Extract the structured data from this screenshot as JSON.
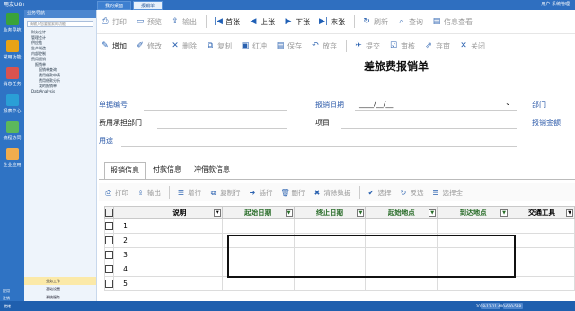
{
  "app": {
    "title": "用友U8+",
    "tabs": [
      "我的桌面",
      "报销单"
    ],
    "user_area": "用户 系统管理"
  },
  "leftbar": [
    "业务导航",
    "常用功能",
    "消息任务",
    "报表中心",
    "流程协同",
    "企业应用"
  ],
  "leftbar_bottom": [
    "应用",
    "注销",
    "退出"
  ],
  "sidebar": {
    "header": "业务导航",
    "search_placeholder": "请输入您要搜索的功能",
    "tree": [
      "财务会计",
      "管理会计",
      "供应链",
      "生产制造",
      "内部控制",
      "费用报销",
      "报销单",
      "报销单查询",
      "费用借款申请",
      "费用借款分析",
      "我的报销单",
      "DataAnalysis"
    ],
    "bottom": [
      "业务工作",
      "基础设置",
      "系统服务"
    ]
  },
  "toolbar1": [
    {
      "icon": "printer-icon",
      "glyph": "⎙",
      "label": "打印",
      "active": false
    },
    {
      "icon": "preview-icon",
      "glyph": "▭",
      "label": "预览",
      "active": false
    },
    {
      "icon": "export-icon",
      "glyph": "⇪",
      "label": "输出",
      "active": false
    },
    {
      "icon": "first-icon",
      "glyph": "|◀",
      "label": "首张",
      "active": true
    },
    {
      "icon": "prev-icon",
      "glyph": "◀",
      "label": "上张",
      "active": true
    },
    {
      "icon": "next-icon",
      "glyph": "▶",
      "label": "下张",
      "active": true
    },
    {
      "icon": "last-icon",
      "glyph": "▶|",
      "label": "末张",
      "active": true
    },
    {
      "icon": "refresh-icon",
      "glyph": "↻",
      "label": "刷新",
      "active": false
    },
    {
      "icon": "query-icon",
      "glyph": "⌕",
      "label": "查询",
      "active": false
    },
    {
      "icon": "info-icon",
      "glyph": "▤",
      "label": "信息查看",
      "active": false
    }
  ],
  "toolbar2": [
    {
      "icon": "add-icon",
      "glyph": "✎",
      "label": "增加",
      "active": true
    },
    {
      "icon": "edit-icon",
      "glyph": "✐",
      "label": "修改",
      "active": false
    },
    {
      "icon": "delete-icon",
      "glyph": "✕",
      "label": "删除",
      "active": false
    },
    {
      "icon": "copy-icon",
      "glyph": "⧉",
      "label": "复制",
      "active": false
    },
    {
      "icon": "redflush-icon",
      "glyph": "▣",
      "label": "红冲",
      "active": false
    },
    {
      "icon": "save-icon",
      "glyph": "▤",
      "label": "保存",
      "active": false
    },
    {
      "icon": "discard-icon",
      "glyph": "↶",
      "label": "放弃",
      "active": false
    },
    {
      "icon": "submit-icon",
      "glyph": "✈",
      "label": "提交",
      "active": false
    },
    {
      "icon": "audit-icon",
      "glyph": "☑",
      "label": "审核",
      "active": false
    },
    {
      "icon": "abandon-icon",
      "glyph": "⇗",
      "label": "弃审",
      "active": false
    },
    {
      "icon": "close-icon",
      "glyph": "✕",
      "label": "关闭",
      "active": false
    }
  ],
  "form": {
    "title": "差旅费报销单",
    "doc_no_label": "单据编号",
    "date_label": "报销日期",
    "date_value": "____/__/__",
    "dept_label": "部门",
    "cost_dept_label": "费用承担部门",
    "project_label": "项目",
    "amount_label": "报销金额",
    "purpose_label": "用途"
  },
  "tabs": [
    "报销信息",
    "付款信息",
    "冲借款信息"
  ],
  "grid_toolbar": [
    {
      "icon": "printer-icon",
      "glyph": "⎙",
      "label": "打印"
    },
    {
      "icon": "export-icon",
      "glyph": "⇪",
      "label": "输出"
    },
    {
      "icon": "add-row-icon",
      "glyph": "☰",
      "label": "增行"
    },
    {
      "icon": "copy-row-icon",
      "glyph": "⧉",
      "label": "复制行"
    },
    {
      "icon": "insert-row-icon",
      "glyph": "➔",
      "label": "插行"
    },
    {
      "icon": "delete-row-icon",
      "glyph": "🗑",
      "label": "删行"
    },
    {
      "icon": "clear-icon",
      "glyph": "✖",
      "label": "清除数据"
    },
    {
      "icon": "select-icon",
      "glyph": "✔",
      "label": "选择"
    },
    {
      "icon": "invert-icon",
      "glyph": "↻",
      "label": "反选"
    },
    {
      "icon": "select-all-icon",
      "glyph": "☰",
      "label": "选择全"
    }
  ],
  "grid": {
    "columns": [
      {
        "label": "说明",
        "green": false
      },
      {
        "label": "起始日期",
        "green": true
      },
      {
        "label": "终止日期",
        "green": true
      },
      {
        "label": "起始地点",
        "green": true
      },
      {
        "label": "到达地点",
        "green": true
      },
      {
        "label": "交通工具",
        "green": false
      }
    ],
    "rows": [
      "1",
      "2",
      "3",
      "4",
      "5"
    ]
  },
  "status": {
    "left": "就绪",
    "right": "2018-12-11    400-600-588"
  }
}
